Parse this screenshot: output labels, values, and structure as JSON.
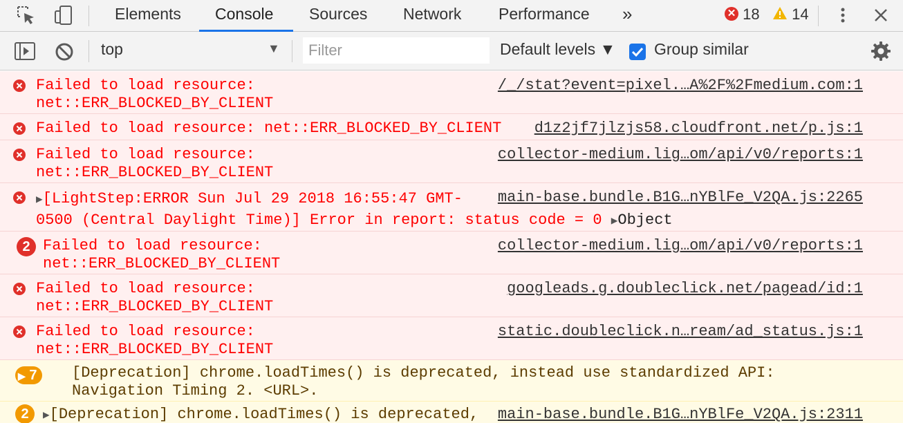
{
  "tabs": {
    "items": [
      "Elements",
      "Console",
      "Sources",
      "Network",
      "Performance"
    ],
    "active": "Console",
    "overflow": "»"
  },
  "counts": {
    "errors": "18",
    "warnings": "14"
  },
  "toolbar": {
    "context": "top",
    "filter_placeholder": "Filter",
    "levels": "Default levels ▼",
    "group_similar_label": "Group similar",
    "group_similar_checked": true
  },
  "colors": {
    "error": "#fe0000",
    "error_bg": "#fff0f0",
    "warn_bg": "#fffbe5",
    "accent": "#1a73e8"
  },
  "logs": [
    {
      "level": "error",
      "icon": "error-x-icon",
      "line1": "Failed to load resource:",
      "line2": "net::ERR_BLOCKED_BY_CLIENT",
      "source": "/_/stat?event=pixel.…A%2F%2Fmedium.com:1"
    },
    {
      "level": "error",
      "icon": "error-x-icon",
      "line1": "Failed to load resource: net::ERR_BLOCKED_BY_CLIENT",
      "source": "d1z2jf7jlzjs58.cloudfront.net/p.js:1"
    },
    {
      "level": "error",
      "icon": "error-x-icon",
      "line1": "Failed to load resource:",
      "line2": "net::ERR_BLOCKED_BY_CLIENT",
      "source": "collector-medium.lig…om/api/v0/reports:1"
    },
    {
      "level": "error",
      "icon": "error-x-icon",
      "line1": "[LightStep:ERROR Sun Jul 29 2018 16:55:47 GMT-",
      "line2": "0500 (Central Daylight Time)] Error in report: status code = 0 ",
      "object": "Object",
      "source": "main-base.bundle.B1G…nYBlFe_V2QA.js:2265"
    },
    {
      "level": "error",
      "count": "2",
      "line1": "Failed to load resource:",
      "line2": "net::ERR_BLOCKED_BY_CLIENT",
      "source": "collector-medium.lig…om/api/v0/reports:1"
    },
    {
      "level": "error",
      "icon": "error-x-icon",
      "line1": "Failed to load resource:",
      "line2": "net::ERR_BLOCKED_BY_CLIENT",
      "source": "googleads.g.doubleclick.net/pagead/id:1"
    },
    {
      "level": "error",
      "icon": "error-x-icon",
      "line1": "Failed to load resource:",
      "line2": "net::ERR_BLOCKED_BY_CLIENT",
      "source": "static.doubleclick.n…ream/ad_status.js:1"
    },
    {
      "level": "warning",
      "count": "7",
      "line1": "[Deprecation] chrome.loadTimes() is deprecated, instead use standardized API:",
      "line2": "Navigation Timing 2. <URL>."
    },
    {
      "level": "warning",
      "count": "2",
      "line1": "[Deprecation] chrome.loadTimes() is deprecated,",
      "source": "main-base.bundle.B1G…nYBlFe_V2QA.js:2311"
    }
  ]
}
